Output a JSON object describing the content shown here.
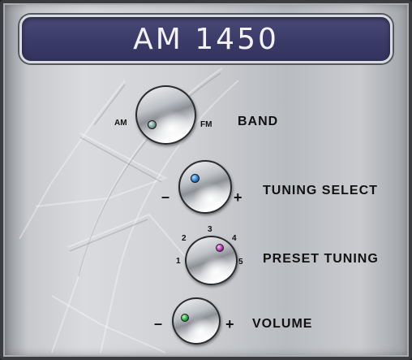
{
  "display": {
    "frequency": "AM 1450"
  },
  "band": {
    "label": "BAND",
    "left_option": "AM",
    "right_option": "FM",
    "indicator_color": "#6f8f86"
  },
  "tuning": {
    "label": "TUNING SELECT",
    "minus": "–",
    "plus": "+",
    "indicator_color": "#1e73c8"
  },
  "preset": {
    "label": "PRESET TUNING",
    "positions": [
      "1",
      "2",
      "3",
      "4",
      "5"
    ],
    "indicator_color": "#b82ab0"
  },
  "volume": {
    "label": "VOLUME",
    "minus": "–",
    "plus": "+",
    "indicator_color": "#1f9a34"
  }
}
